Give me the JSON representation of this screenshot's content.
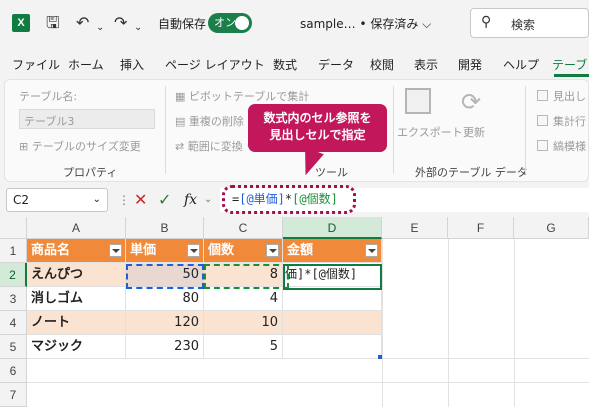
{
  "titlebar": {
    "app_icon_letter": "X",
    "autosave_label": "自動保存",
    "autosave_toggle": "オン",
    "filename": "sample… • 保存済み ⌵",
    "search_placeholder": "検索"
  },
  "tabs": [
    "ファイル",
    "ホーム",
    "挿入",
    "ページ レイアウト",
    "数式",
    "データ",
    "校閲",
    "表示",
    "開発",
    "ヘルプ",
    "テーブ"
  ],
  "ribbon": {
    "table_name_label": "テーブル名:",
    "table_name_value": "テーブル3",
    "resize_label": "テーブルのサイズ変更",
    "group_properties": "プロパティ",
    "pivot_label": "ピボットテーブルで集計",
    "dedupe_label": "重複の削除",
    "range_label": "範囲に変換",
    "group_tools": "ツール",
    "export_label": "エクスポート",
    "refresh_label": "更新",
    "group_external": "外部のテーブル データ",
    "opt1": "見出し",
    "opt2": "集計行",
    "opt3": "縞模様"
  },
  "callout": {
    "line1": "数式内のセル参照を",
    "line2": "見出しセルで指定"
  },
  "formula_bar": {
    "name_box": "C2",
    "cancel_icon": "✕",
    "enter_icon": "✓",
    "fx": "fx",
    "formula_eq": "=",
    "ref1": "[@単価]",
    "op": "*",
    "ref2": "[@個数]"
  },
  "grid": {
    "columns": [
      "A",
      "B",
      "C",
      "D",
      "E",
      "F",
      "G"
    ],
    "rows": [
      "1",
      "2",
      "3",
      "4",
      "5",
      "6",
      "7"
    ],
    "headers": [
      "商品名",
      "単価",
      "個数",
      "金額"
    ],
    "data": [
      [
        "えんぴつ",
        "50",
        "8",
        "価]*[@個数]"
      ],
      [
        "消しゴム",
        "80",
        "4",
        ""
      ],
      [
        "ノート",
        "120",
        "10",
        ""
      ],
      [
        "マジック",
        "230",
        "5",
        ""
      ]
    ]
  },
  "colors": {
    "accent": "#107c41",
    "table_header": "#f08a3a",
    "table_band": "#fbe3d2",
    "callout": "#c2185b"
  }
}
